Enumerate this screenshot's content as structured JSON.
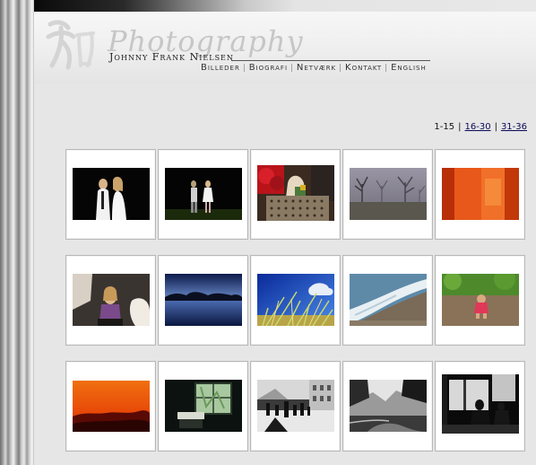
{
  "header": {
    "script_title": "Photography",
    "name": "Johnny Frank Nielsen"
  },
  "nav": {
    "items": [
      "Billeder",
      "Biografi",
      "Netværk",
      "Kontakt",
      "English"
    ]
  },
  "pager": {
    "current": "1-15",
    "links": [
      "16-30",
      "31-36"
    ],
    "separator": "|"
  },
  "gallery": {
    "columns": 5,
    "rows": 3,
    "thumbnails": [
      "couple-dark-backdrop",
      "couple-night-field",
      "child-with-camera-red",
      "foggy-trees-field",
      "orange-abstract",
      "child-in-chair-topdown",
      "lake-at-dusk",
      "grass-against-blue-sky",
      "foamy-wave-beach",
      "child-playing-forest",
      "orange-sunset-hills",
      "dark-window-room",
      "black-white-street",
      "black-white-mountain-river",
      "black-white-cafe-silhouettes"
    ]
  },
  "colors": {
    "background": "#e6e6e6",
    "link": "#0a0a5a",
    "text": "#111111"
  }
}
